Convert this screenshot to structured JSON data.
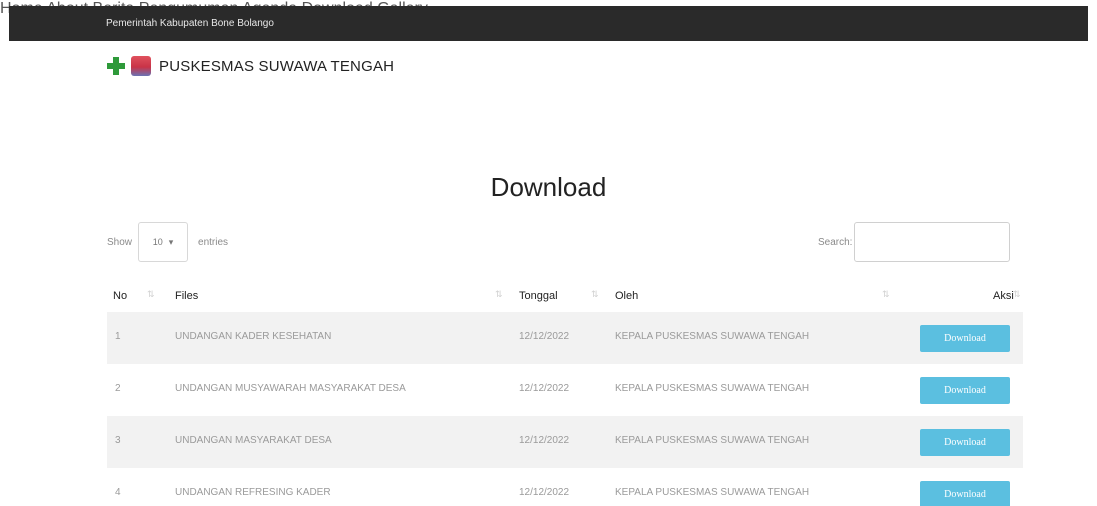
{
  "topbar": {
    "text": "Pemerintah Kabupaten Bone Bolango"
  },
  "header": {
    "site_title": "PUSKESMAS SUWAWA TENGAH",
    "nav": [
      "Home",
      "About",
      "Berita",
      "Pengumuman",
      "Agenda",
      "Download",
      "Gallery"
    ]
  },
  "page": {
    "title": "Download"
  },
  "controls": {
    "show_label": "Show",
    "entries_value": "10",
    "entries_label": "entries",
    "search_label": "Search:",
    "search_value": ""
  },
  "table": {
    "headers": [
      "No",
      "Files",
      "Tonggal",
      "Oleh",
      "Aksi"
    ],
    "rows": [
      {
        "no": "1",
        "file": "UNDANGAN KADER KESEHATAN",
        "date": "12/12/2022",
        "by": "KEPALA PUSKESMAS SUWAWA TENGAH",
        "action": "Download"
      },
      {
        "no": "2",
        "file": "UNDANGAN MUSYAWARAH MASYARAKAT DESA",
        "date": "12/12/2022",
        "by": "KEPALA PUSKESMAS SUWAWA TENGAH",
        "action": "Download"
      },
      {
        "no": "3",
        "file": "UNDANGAN MASYARAKAT DESA",
        "date": "12/12/2022",
        "by": "KEPALA PUSKESMAS SUWAWA TENGAH",
        "action": "Download"
      },
      {
        "no": "4",
        "file": "UNDANGAN REFRESING KADER",
        "date": "12/12/2022",
        "by": "KEPALA PUSKESMAS SUWAWA TENGAH",
        "action": "Download"
      }
    ]
  },
  "colors": {
    "topbar": "#2a2a2a",
    "button": "#5bbfe0",
    "row_stripe": "#f2f2f2"
  },
  "icons": {
    "logo_left": "green-cross-icon",
    "logo_right": "crest-icon",
    "sort": "sort-arrows-icon",
    "select": "select-arrows-icon"
  }
}
